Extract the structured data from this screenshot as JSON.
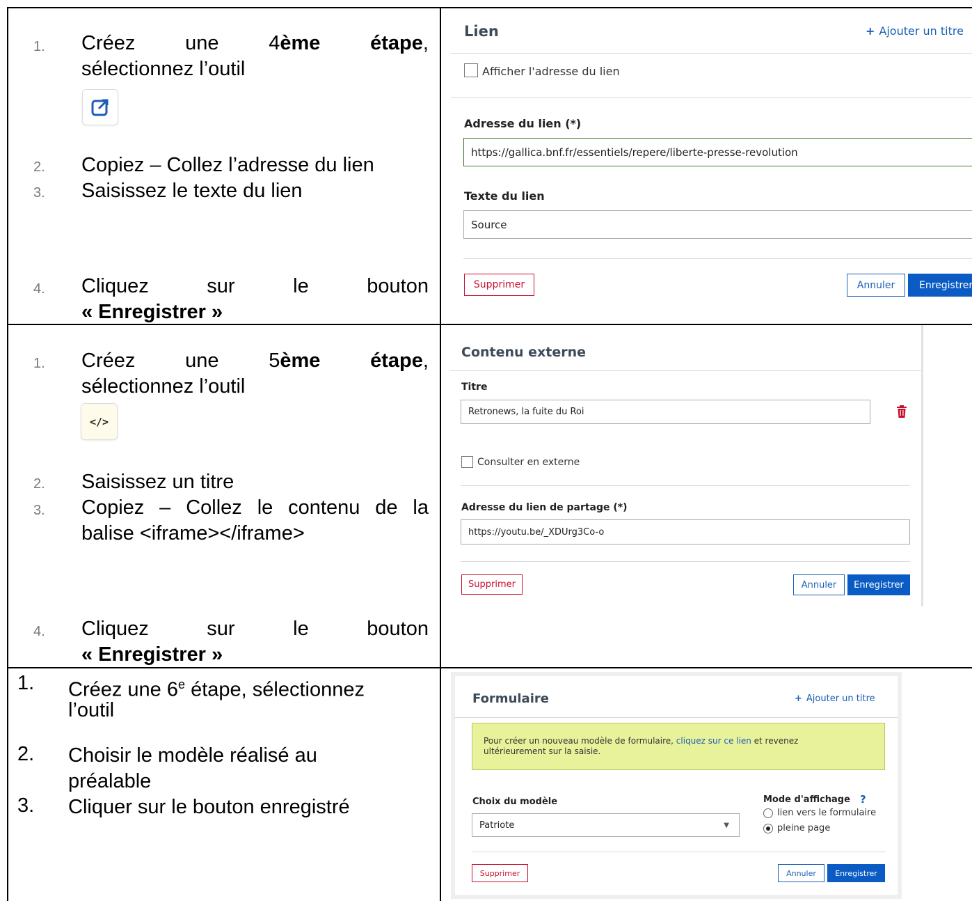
{
  "left": {
    "row1": {
      "n1": "1.",
      "s1_w1": "Créez",
      "s1_w2": "une",
      "s1_num": "4",
      "s1_w3": "ème",
      "s1_w4": "étape",
      "s1_comma": ",",
      "s1_line2": "sélectionnez l’outil",
      "n2": "2.",
      "s2": "Copiez – Collez l’adresse du lien",
      "n3": "3.",
      "s3": "Saisissez le texte du lien",
      "n4": "4.",
      "s4_w1": "Cliquez",
      "s4_w2": "sur",
      "s4_w3": "le",
      "s4_w4": "bouton",
      "s4_line2": "« Enregistrer »"
    },
    "row2": {
      "n1": "1.",
      "s1_w1": "Créez",
      "s1_w2": "une",
      "s1_num": "5",
      "s1_w3": "ème",
      "s1_w4": "étape",
      "s1_comma": ",",
      "s1_line2": "sélectionnez l’outil",
      "tool_icon_text": "</>",
      "n2": "2.",
      "s2": "Saisissez un titre",
      "n3": "3.",
      "s3_w1": "Copiez",
      "s3_w2": "–",
      "s3_w3": "Collez",
      "s3_w4": "le",
      "s3_w5": "contenu",
      "s3_w6": "de",
      "s3_w7": "la",
      "s3_line2": "balise <iframe></iframe>",
      "n4": "4.",
      "s4_w1": "Cliquez",
      "s4_w2": "sur",
      "s4_w3": "le",
      "s4_w4": "bouton",
      "s4_line2": "« Enregistrer »"
    },
    "row3": {
      "n1": "1.",
      "s1_a": "Créez une 6",
      "s1_sup": "e",
      "s1_b": " étape, sélectionnez",
      "s1_line2": "l’outil",
      "n2": "2.",
      "s2": "Choisir le modèle réalisé au",
      "s2_line2": "préalable",
      "n3": "3.",
      "s3": "Cliquer sur le bouton enregistré"
    }
  },
  "panel_lien": {
    "title": "Lien",
    "add_title": "Ajouter un titre",
    "show_address_label": "Afficher l'adresse du lien",
    "address_label": "Adresse du lien (*)",
    "address_value": "https://gallica.bnf.fr/essentiels/repere/liberte-presse-revolution",
    "text_label": "Texte du lien",
    "text_value": "Source",
    "delete": "Supprimer",
    "cancel": "Annuler",
    "save": "Enregistrer"
  },
  "panel_externe": {
    "title": "Contenu externe",
    "title_label": "Titre",
    "title_value": "Retronews, la fuite du Roi",
    "consult_label": "Consulter en externe",
    "share_label": "Adresse du lien de partage (*)",
    "share_value": "https://youtu.be/_XDUrg3Co-o",
    "delete": "Supprimer",
    "cancel": "Annuler",
    "save": "Enregistrer"
  },
  "panel_form": {
    "title": "Formulaire",
    "add_title": "Ajouter un titre",
    "notice_a": "Pour créer un nouveau modèle de formulaire, ",
    "notice_link": "cliquez sur ce lien",
    "notice_b": " et revenez",
    "notice_line2": "ultérieurement sur la saisie.",
    "model_label": "Choix du modèle",
    "model_value": "Patriote",
    "mode_label": "Mode d'affichage",
    "help": "?",
    "option1": "lien vers le formulaire",
    "option2": "pleine page",
    "selected_option": "pleine page",
    "delete": "Supprimer",
    "cancel": "Annuler",
    "save": "Enregistrer"
  }
}
